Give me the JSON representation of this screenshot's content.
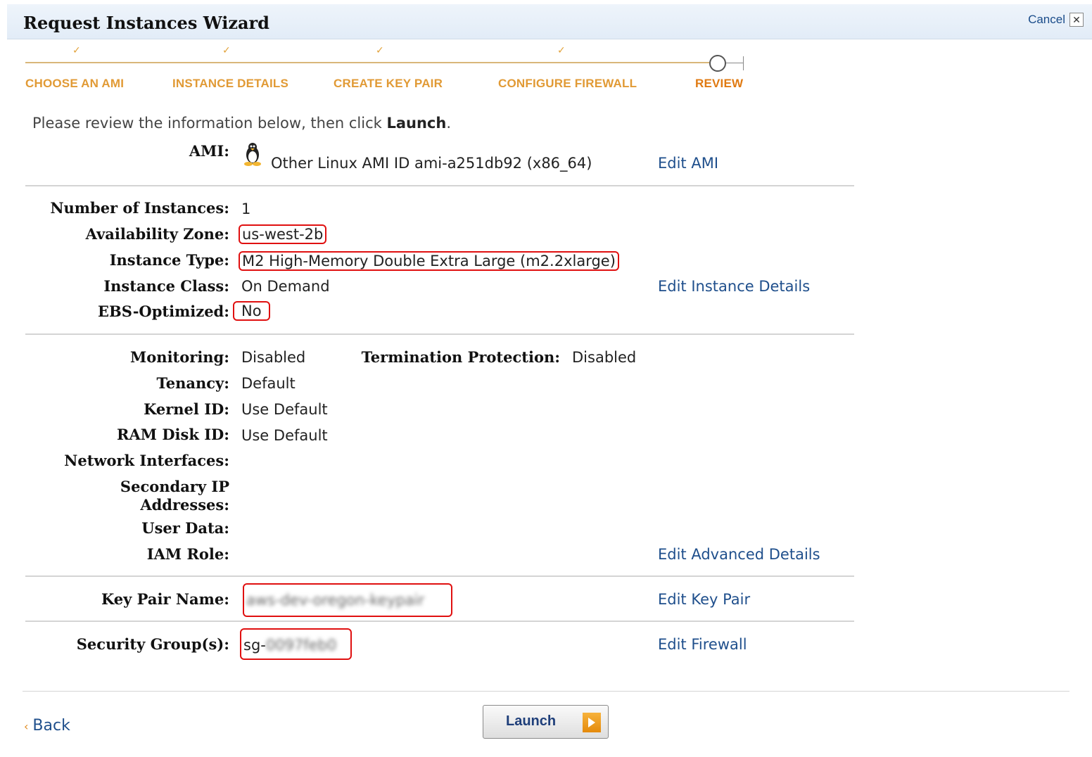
{
  "wizard": {
    "title": "Request Instances Wizard",
    "cancel_label": "Cancel",
    "cancel_x": "✕"
  },
  "steps": [
    {
      "label": "CHOOSE AN AMI",
      "done": true
    },
    {
      "label": "INSTANCE DETAILS",
      "done": true
    },
    {
      "label": "CREATE KEY PAIR",
      "done": true
    },
    {
      "label": "CONFIGURE FIREWALL",
      "done": true
    },
    {
      "label": "REVIEW",
      "done": false,
      "active": true
    }
  ],
  "intro": {
    "text": "Please review the information below, then click ",
    "bold": "Launch",
    "end": "."
  },
  "ami": {
    "label": "AMI:",
    "value": "Other Linux AMI ID ami-a251db92 (x86_64)",
    "icon": "linux-penguin-icon",
    "edit": "Edit AMI"
  },
  "instance": {
    "count_label": "Number of Instances:",
    "count": "1",
    "zone_label": "Availability Zone:",
    "zone": "us-west-2b",
    "type_label": "Instance Type:",
    "type": "M2 High-Memory Double Extra Large (m2.2xlarge)",
    "class_label": "Instance Class:",
    "class": "On Demand",
    "ebs_label": "EBS-Optimized:",
    "ebs": "No",
    "edit": "Edit Instance Details"
  },
  "advanced": {
    "monitoring_label": "Monitoring:",
    "monitoring": "Disabled",
    "termination_label": "Termination Protection:",
    "termination": "Disabled",
    "tenancy_label": "Tenancy:",
    "tenancy": "Default",
    "kernel_label": "Kernel ID:",
    "kernel": "Use Default",
    "ramdisk_label": "RAM Disk ID:",
    "ramdisk": "Use Default",
    "network_label": "Network Interfaces:",
    "secondary_ip_label_1": "Secondary IP",
    "secondary_ip_label_2": "Addresses:",
    "userdata_label": "User Data:",
    "iam_label": "IAM Role:",
    "edit": "Edit Advanced Details"
  },
  "keypair": {
    "label": "Key Pair Name:",
    "value": "aws-dev-oregon-keypair",
    "edit": "Edit Key Pair"
  },
  "security": {
    "label": "Security Group(s):",
    "prefix": "sg-",
    "value_blurred": "0097feb0",
    "edit": "Edit Firewall"
  },
  "footer": {
    "back": "Back",
    "back_chevron": "‹",
    "launch": "Launch"
  },
  "colors": {
    "accent": "#e19a35",
    "link": "#1f4f8c",
    "highlight": "#e01010"
  }
}
